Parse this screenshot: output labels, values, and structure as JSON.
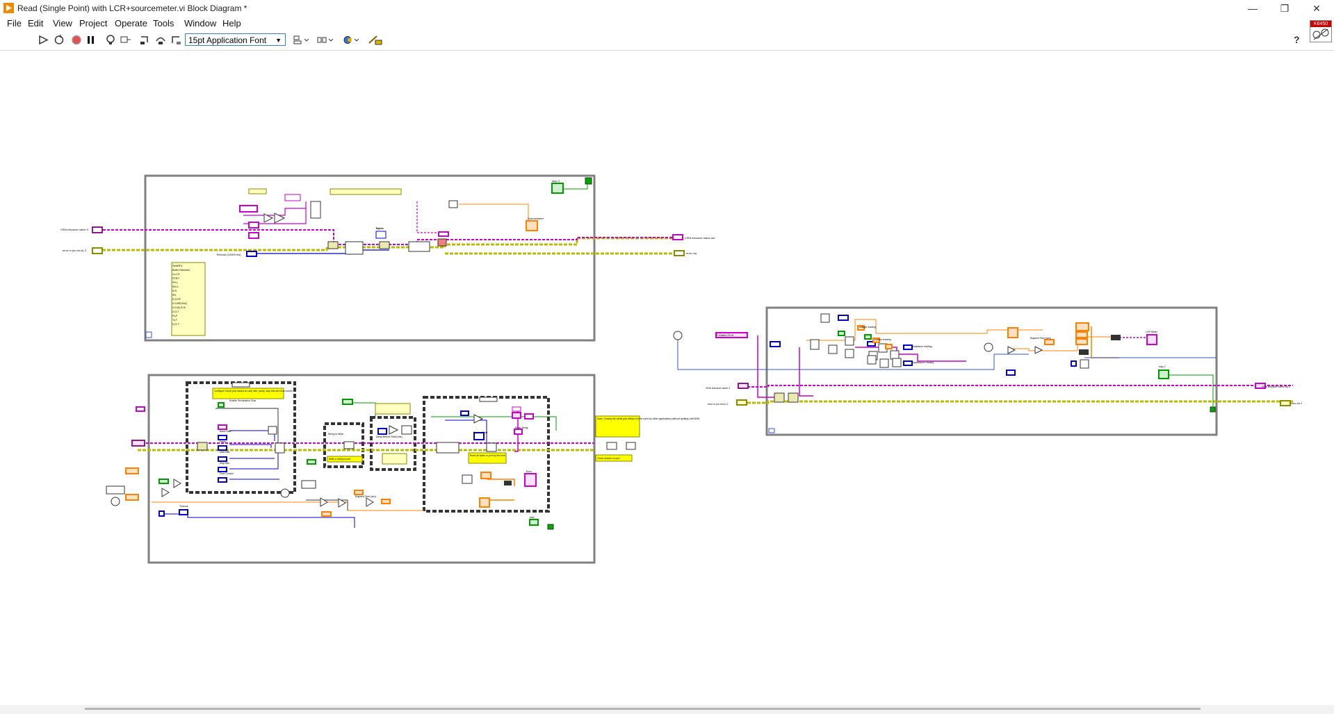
{
  "window": {
    "title": "Read (Single Point) with LCR+sourcemeter.vi Block Diagram *",
    "controls": [
      "—",
      "❐",
      "✕"
    ]
  },
  "menu": [
    "File",
    "Edit",
    "View",
    "Project",
    "Operate",
    "Tools",
    "Window",
    "Help"
  ],
  "toolbar": {
    "font_selector": "15pt Application Font",
    "help_label": "?"
  },
  "connector_pane_label": "K6450",
  "colors": {
    "visa_wire": "#cc00cc",
    "error_wire": "#b9b900",
    "int_wire": "#0000cc",
    "num_wire": "#ff8000",
    "bool_wire": "#009900",
    "structure_border": "#808080",
    "note_fill": "#ffff00"
  },
  "diagram": {
    "top_loop_note_header": "SenRPc",
    "top_loop_note_lines": [
      "Buffer Elements",
      "Cu,CH",
      "PCR,F",
      "PR,L",
      "RH,G",
      "R,R",
      "RH",
      "D,G,RF",
      "D,G,BR,RAQ",
      "D,G,BLOCK",
      "D,G,T",
      "Ps,P",
      "Tu,T",
      "D,G,T"
    ],
    "top_labels": [
      "VISA resource name 4",
      "error in (no error) 3",
      "VISA resource name out",
      "error out",
      "Timeout (10000 ms)",
      "Bytes",
      "Sourcemeter",
      "stop 3"
    ],
    "bottom_notes": [
      "Configure Serial port based on user rate, parity, stop bits and flow control",
      "Enable Termination Char",
      "Write a string to port",
      "Read all bytes in port by the limit",
      "Note: Closing the serial port allows it to be used by other applications without quitting LabVIEW.",
      "Close session to port"
    ],
    "bottom_labels": [
      "Baud Rate",
      "Parity",
      "Data Bits",
      "Stop Bits",
      "Flow Control",
      "String to Write",
      "Delay Before Read (ms)",
      "Bytes at Port",
      "Read String",
      "Timeout",
      "Elapsed Time (sec)",
      "stop",
      "Error"
    ],
    "right_labels": [
      "VISA resource name 2",
      "error in (no error) 2",
      "VISA resource name out 2",
      "error out 2",
      "LCR Meter",
      "Elapsed Time (sec)",
      "stop 2",
      "voltage reading",
      "current reading",
      "resistance reading",
      "capacitance reading"
    ],
    "right_string_const": "F:\\Data\\LCR.txt"
  }
}
